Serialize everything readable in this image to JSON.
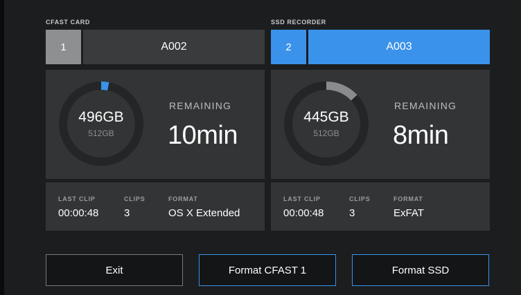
{
  "left_media": {
    "section_label": "CFAST CARD",
    "slot_number": "1",
    "clip_name": "A002",
    "active": false,
    "capacity_used": "496GB",
    "capacity_total": "512GB",
    "fill_fraction": 0.03,
    "ring_color": "#3a92ea",
    "remaining_label": "REMAINING",
    "remaining_time": "10min",
    "info": {
      "last_clip_label": "LAST CLIP",
      "last_clip_value": "00:00:48",
      "clips_label": "CLIPS",
      "clips_value": "3",
      "format_label": "FORMAT",
      "format_value": "OS X Extended"
    }
  },
  "right_media": {
    "section_label": "SSD RECORDER",
    "slot_number": "2",
    "clip_name": "A003",
    "active": true,
    "capacity_used": "445GB",
    "capacity_total": "512GB",
    "fill_fraction": 0.13,
    "ring_color": "#8a8b8d",
    "remaining_label": "REMAINING",
    "remaining_time": "8min",
    "info": {
      "last_clip_label": "LAST CLIP",
      "last_clip_value": "00:00:48",
      "clips_label": "CLIPS",
      "clips_value": "3",
      "format_label": "FORMAT",
      "format_value": "ExFAT"
    }
  },
  "buttons": {
    "exit": "Exit",
    "format_cfast": "Format CFAST 1",
    "format_ssd": "Format SSD"
  },
  "colors": {
    "accent": "#3a92ea",
    "ring_track": "#242527",
    "panel": "#333436"
  }
}
